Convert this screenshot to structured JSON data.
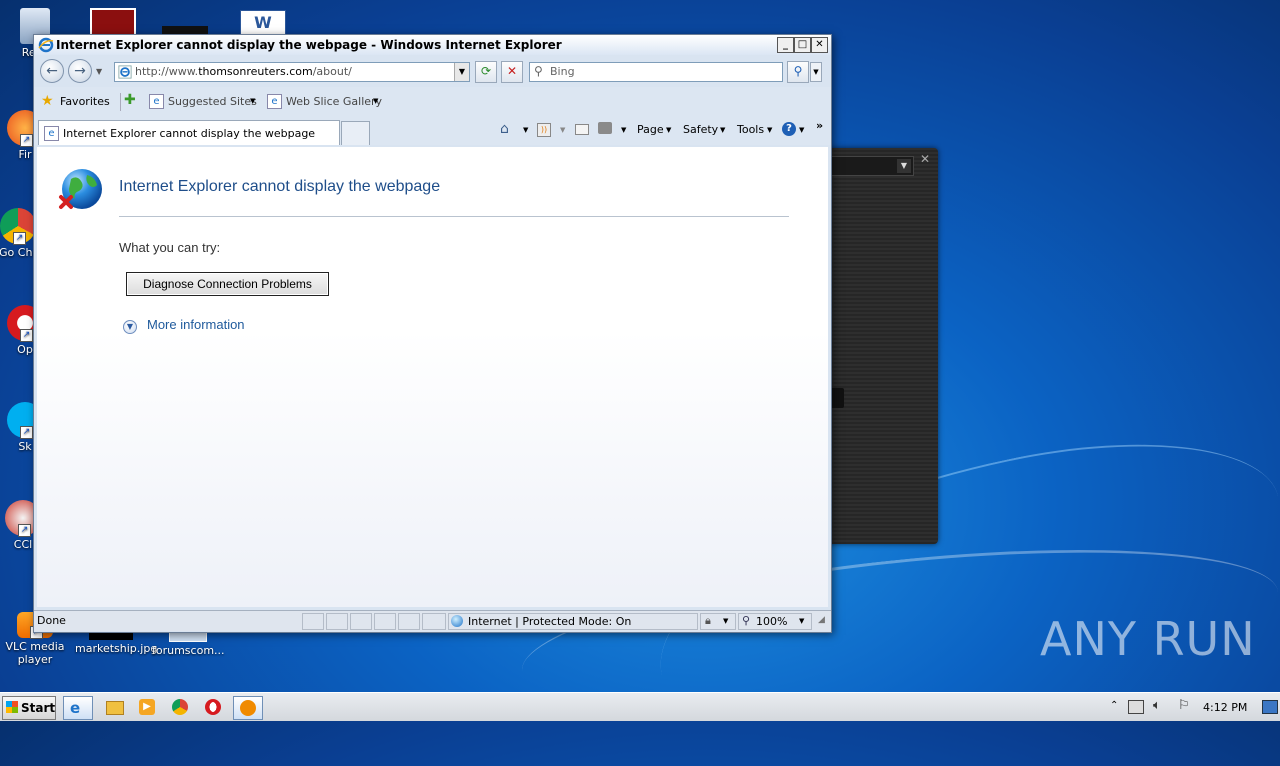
{
  "desktop": {
    "icons": [
      {
        "label": "Recy"
      },
      {
        "label": "Fir"
      },
      {
        "label": "Go Chr"
      },
      {
        "label": "Op"
      },
      {
        "label": "Sk"
      },
      {
        "label": "CCl"
      },
      {
        "label": "VLC media player"
      },
      {
        "label": "marketship.jpg"
      },
      {
        "label": "forumscom..."
      }
    ]
  },
  "browser": {
    "window_title": "Internet Explorer cannot display the webpage - Windows Internet Explorer",
    "address": {
      "prefix": "http://www.",
      "domain": "thomsonreuters.com",
      "path": "/about/"
    },
    "search_placeholder": "Bing",
    "favorites": {
      "label": "Favorites",
      "items": [
        "Suggested Sites",
        "Web Slice Gallery"
      ]
    },
    "tab_title": "Internet Explorer cannot display the webpage",
    "commands": {
      "page": "Page",
      "safety": "Safety",
      "tools": "Tools"
    },
    "error": {
      "title": "Internet Explorer cannot display the webpage",
      "try_text": "What you can try:",
      "diagnose_button": "Diagnose Connection Problems",
      "more_info": "More information"
    },
    "status": {
      "text": "Done",
      "zone": "Internet | Protected Mode: On",
      "zoom": "100%"
    }
  },
  "taskbar": {
    "start_label": "Start",
    "clock": "4:12 PM"
  },
  "watermark": "ANY RUN",
  "colors": {
    "link": "#1f5a9c",
    "error_title": "#1f4e8a"
  }
}
